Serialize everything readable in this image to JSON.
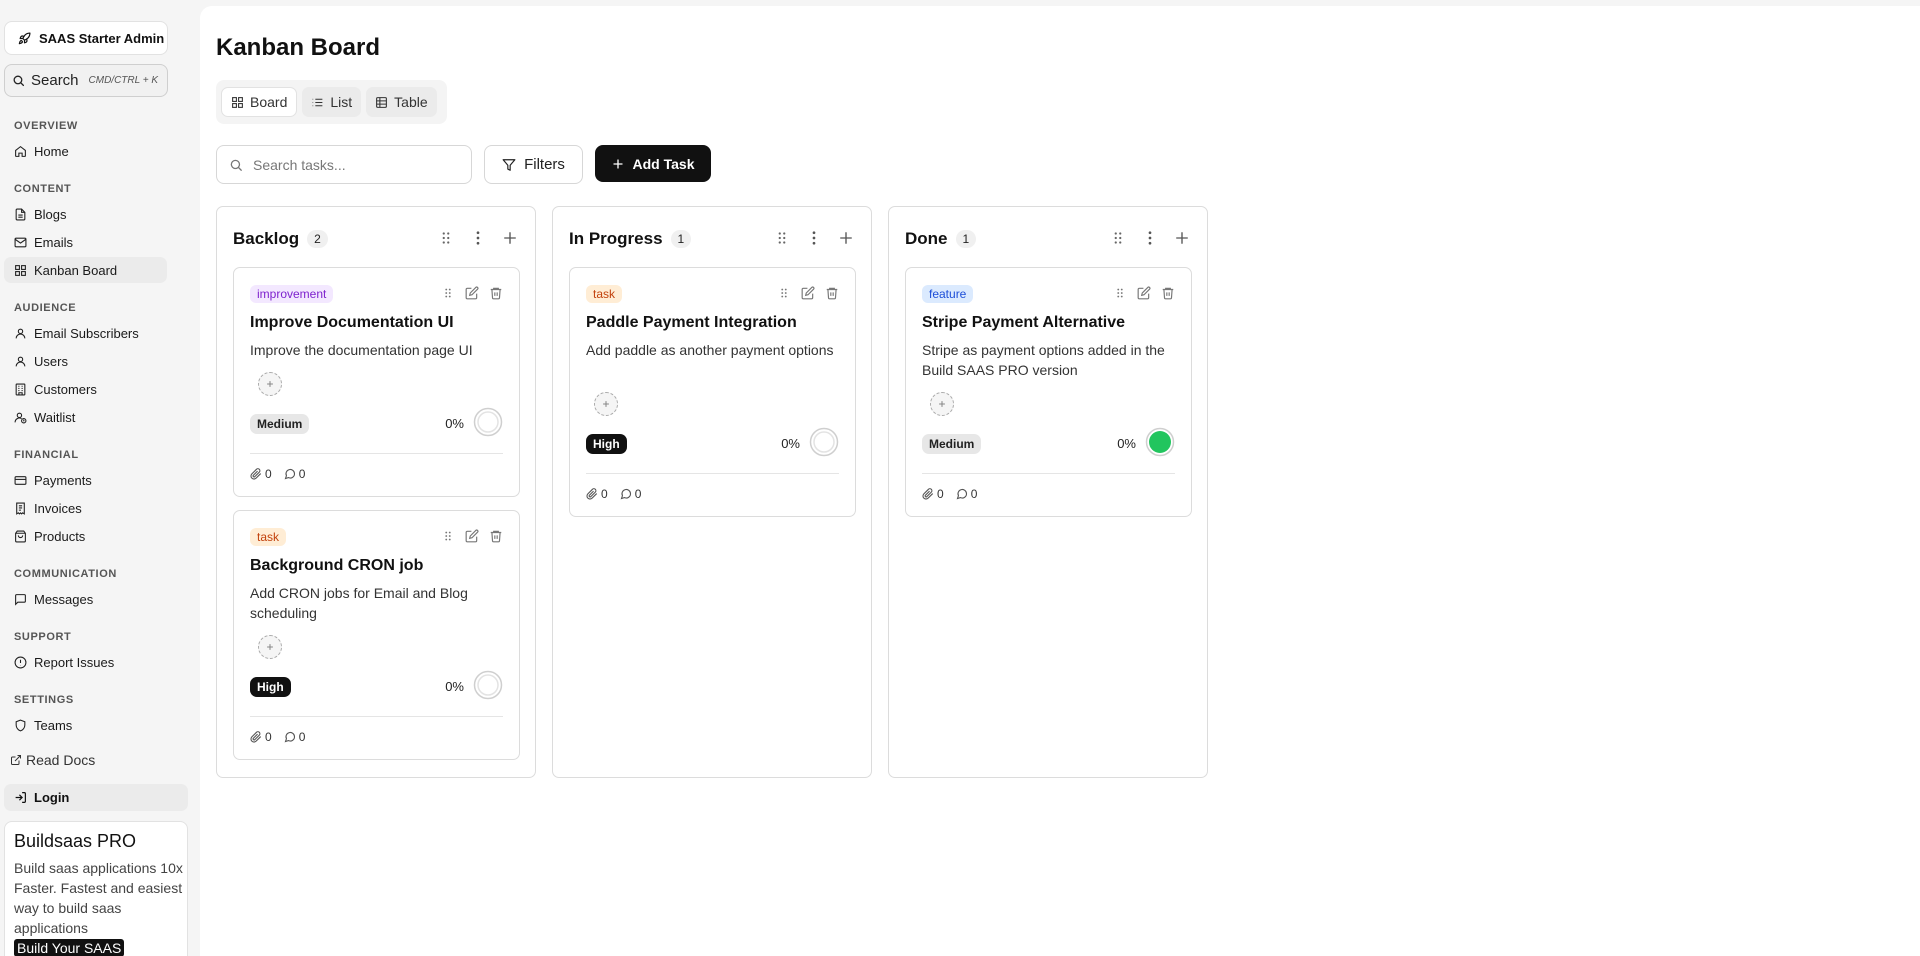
{
  "sidebar": {
    "brand": "SAAS Starter Admin",
    "search_label": "Search",
    "search_shortcut": "CMD/CTRL + K",
    "groups": {
      "overview": "OVERVIEW",
      "content": "CONTENT",
      "audience": "AUDIENCE",
      "financial": "FINANCIAL",
      "communication": "COMMUNICATION",
      "support": "SUPPORT",
      "settings": "SETTINGS"
    },
    "items": {
      "home": "Home",
      "blogs": "Blogs",
      "emails": "Emails",
      "kanban": "Kanban Board",
      "subscribers": "Email Subscribers",
      "users": "Users",
      "customers": "Customers",
      "waitlist": "Waitlist",
      "payments": "Payments",
      "invoices": "Invoices",
      "products": "Products",
      "messages": "Messages",
      "report": "Report Issues",
      "teams": "Teams"
    },
    "read_docs": "Read Docs",
    "login": "Login",
    "promo": {
      "title": "Buildsaas PRO",
      "text": "Build saas applications 10x Faster. Fastest and easiest way to build saas applications",
      "cta": "Build Your SAAS"
    }
  },
  "main": {
    "title": "Kanban Board",
    "view_tabs": {
      "board": "Board",
      "list": "List",
      "table": "Table"
    },
    "search_placeholder": "Search tasks...",
    "filters": "Filters",
    "add_task": "Add Task"
  },
  "columns": [
    {
      "title": "Backlog",
      "count": "2",
      "cards": [
        {
          "badge": "improvement",
          "title": "Improve Documentation UI",
          "desc": "Improve the documentation page UI",
          "priority": "Medium",
          "percent": "0%",
          "attachments": "0",
          "comments": "0"
        },
        {
          "badge": "task",
          "title": "Background CRON job",
          "desc": "Add CRON jobs for Email and Blog scheduling",
          "priority": "High",
          "percent": "0%",
          "attachments": "0",
          "comments": "0"
        }
      ]
    },
    {
      "title": "In Progress",
      "count": "1",
      "cards": [
        {
          "badge": "task",
          "title": "Paddle Payment Integration",
          "desc": "Add paddle as another payment options",
          "priority": "High",
          "percent": "0%",
          "attachments": "0",
          "comments": "0"
        }
      ]
    },
    {
      "title": "Done",
      "count": "1",
      "cards": [
        {
          "badge": "feature",
          "title": "Stripe Payment Alternative",
          "desc": "Stripe as payment options added in the Build SAAS PRO version",
          "priority": "Medium",
          "percent": "0%",
          "attachments": "0",
          "comments": "0"
        }
      ]
    }
  ],
  "colors": {
    "improvement_bg": "#f3e8ff",
    "improvement_fg": "#7e22ce",
    "task_bg": "#ffedd5",
    "task_fg": "#c2410c",
    "feature_bg": "#dbeafe",
    "feature_fg": "#1d4ed8",
    "done_green": "#22c55e"
  }
}
